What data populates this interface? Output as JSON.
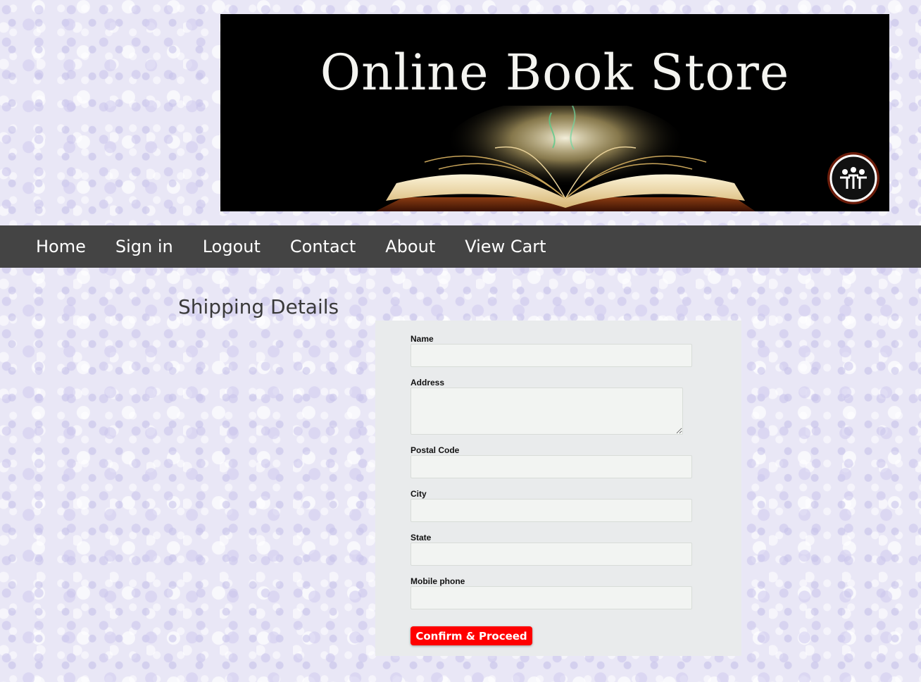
{
  "banner": {
    "title": "Online Book Store"
  },
  "nav": {
    "items": [
      {
        "label": "Home"
      },
      {
        "label": "Sign in"
      },
      {
        "label": "Logout"
      },
      {
        "label": "Contact"
      },
      {
        "label": "About"
      },
      {
        "label": "View Cart"
      }
    ],
    "background_color": "#444444"
  },
  "page": {
    "heading": "Shipping Details"
  },
  "form": {
    "name": {
      "label": "Name",
      "value": ""
    },
    "address": {
      "label": "Address",
      "value": ""
    },
    "postal_code": {
      "label": "Postal Code",
      "value": ""
    },
    "city": {
      "label": "City",
      "value": ""
    },
    "state": {
      "label": "State",
      "value": ""
    },
    "mobile_phone": {
      "label": "Mobile phone",
      "value": ""
    },
    "submit_label": "Confirm & Proceed",
    "submit_color": "#ff0000"
  },
  "icons": {
    "banner_logo": "people-circle-icon",
    "banner_art": "open-book-illustration"
  }
}
